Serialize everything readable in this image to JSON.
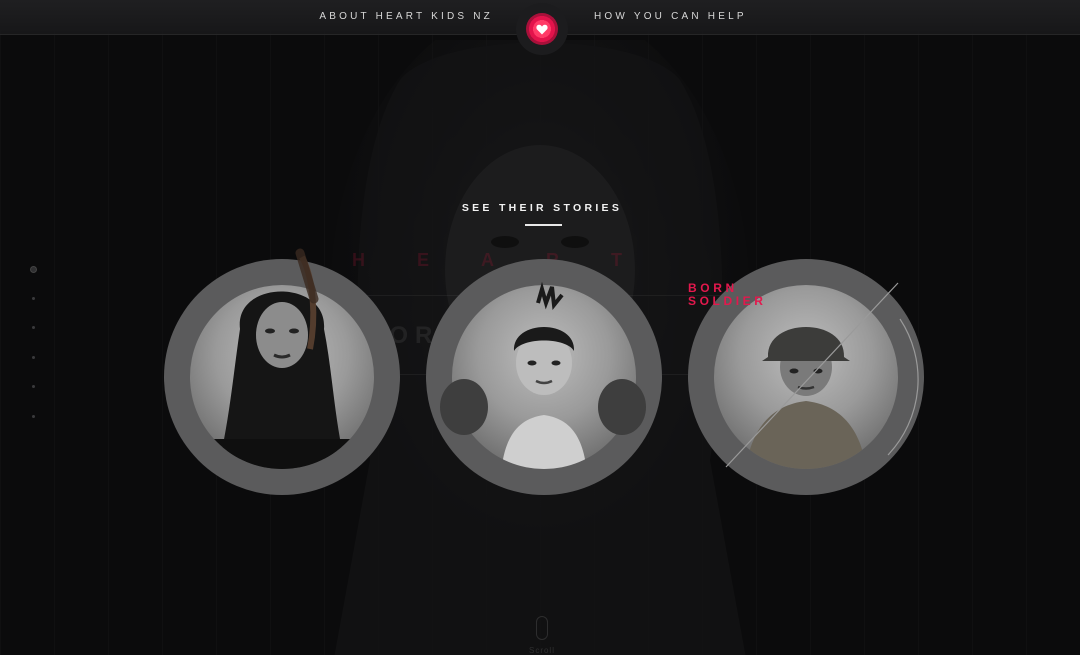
{
  "nav": {
    "about_label": "ABOUT HEART KIDS NZ",
    "help_label": "HOW YOU CAN HELP"
  },
  "logo": {
    "icon": "heart-icon",
    "accent_color": "#e3134b"
  },
  "section": {
    "title": "SEE THEIR STORIES"
  },
  "stories": [
    {
      "name": "girl-portrait"
    },
    {
      "name": "boxer-portrait"
    },
    {
      "name": "soldier-portrait",
      "label_line1": "BORN",
      "label_line2": "SOLDIER"
    }
  ],
  "background_ghost": {
    "row1": "HEART",
    "row2": "BORN WARRIOR"
  },
  "side_nav": {
    "dot_count": 6,
    "active_index": 0
  },
  "scroll": {
    "label": "Scroll"
  },
  "colors": {
    "background": "#0b0b0c",
    "accent": "#e3184d",
    "circle": "#5b5b5c"
  }
}
